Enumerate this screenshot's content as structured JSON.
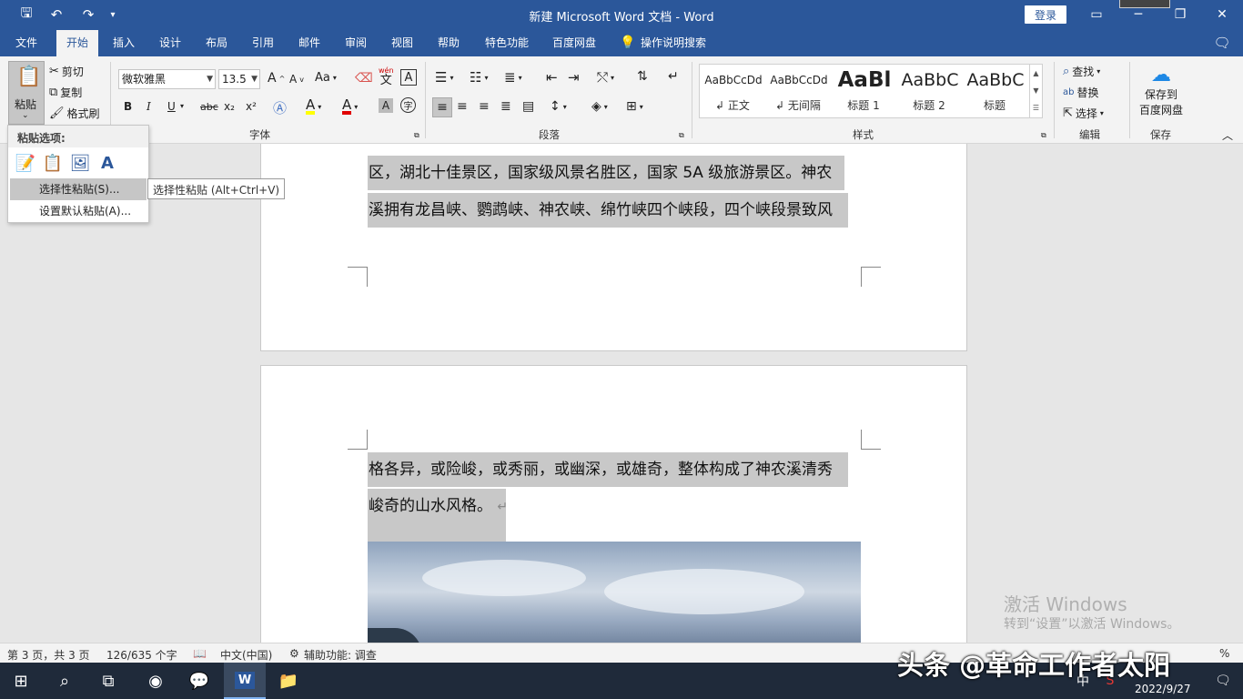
{
  "titlebar": {
    "title": "新建 Microsoft Word 文档  -  Word",
    "login": "登录"
  },
  "tabs": [
    {
      "label": "文件"
    },
    {
      "label": "开始"
    },
    {
      "label": "插入"
    },
    {
      "label": "设计"
    },
    {
      "label": "布局"
    },
    {
      "label": "引用"
    },
    {
      "label": "邮件"
    },
    {
      "label": "审阅"
    },
    {
      "label": "视图"
    },
    {
      "label": "帮助"
    },
    {
      "label": "特色功能"
    },
    {
      "label": "百度网盘"
    }
  ],
  "tell_me": "操作说明搜索",
  "clipboard": {
    "paste": "粘贴",
    "cut": "剪切",
    "copy": "复制",
    "format_painter": "格式刷"
  },
  "font": {
    "name": "微软雅黑",
    "size": "13.5",
    "group_label": "字体",
    "bold": "B",
    "italic": "I",
    "underline": "U",
    "strike": "abc",
    "subscript": "x₂",
    "superscript": "x²",
    "aa": "Aa",
    "pinyin_top": "wén",
    "pinyin_char": "文",
    "grow": "A",
    "shrink": "A",
    "highlight": "A",
    "font_color": "A"
  },
  "paragraph": {
    "group_label": "段落"
  },
  "styles": {
    "group_label": "样式",
    "items": [
      {
        "sample": "AaBbCcDd",
        "name": "正文"
      },
      {
        "sample": "AaBbCcDd",
        "name": "无间隔"
      },
      {
        "sample": "AaBl",
        "name": "标题 1"
      },
      {
        "sample": "AaBbC",
        "name": "标题 2"
      },
      {
        "sample": "AaBbC",
        "name": "标题"
      }
    ]
  },
  "editing": {
    "find": "查找",
    "replace": "替换",
    "select": "选择",
    "group_label": "编辑"
  },
  "save": {
    "label_line1": "保存到",
    "label_line2": "百度网盘",
    "group_label": "保存"
  },
  "paste_menu": {
    "header": "粘贴选项:",
    "item1": "选择性粘贴(S)...",
    "item2": "设置默认粘贴(A)...",
    "tooltip": "选择性粘贴 (Alt+Ctrl+V)"
  },
  "document": {
    "page1_lines": [
      "区，湖北十佳景区，国家级风景名胜区，国家 5A 级旅游景区。神农",
      "溪拥有龙昌峡、鹦鹉峡、神农峡、绵竹峡四个峡段，四个峡段景致风"
    ],
    "page2_lines": [
      "格各异，或险峻，或秀丽，或幽深，或雄奇，整体构成了神农溪清秀",
      "峻奇的山水风格。"
    ],
    "para_mark": "↵"
  },
  "watermark": {
    "line1": "激活 Windows",
    "line2": "转到“设置”以激活 Windows。"
  },
  "status": {
    "page": "第 3 页，共 3 页",
    "words": "126/635 个字",
    "lang": "中文(中国)",
    "access": "辅助功能: 调查",
    "zoom": "%"
  },
  "taskbar": {
    "date": "2022/9/27",
    "ime": "中"
  },
  "overlay": "头条 @革命工作者太阳"
}
